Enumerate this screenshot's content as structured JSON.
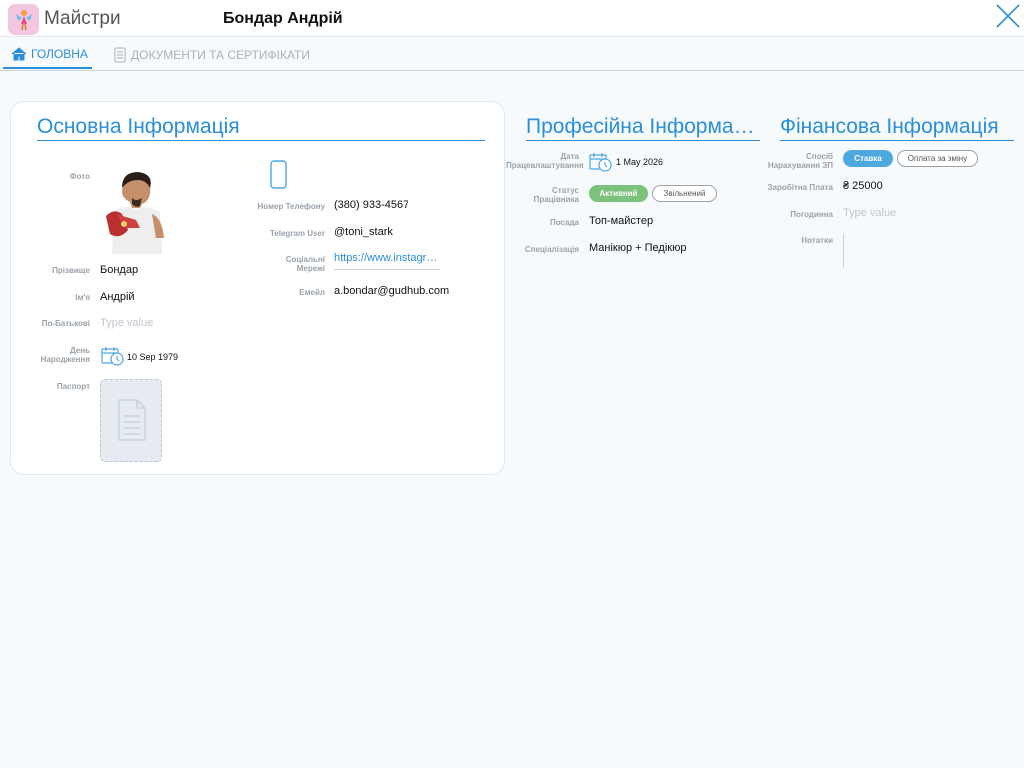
{
  "header": {
    "app_name": "Майстри",
    "record_title": "Бондар Андрій"
  },
  "tabs": [
    {
      "label": "ГОЛОВНА",
      "icon": "home-icon",
      "active": true
    },
    {
      "label": "ДОКУМЕНТИ ТА СЕРТИФІКАТИ",
      "icon": "document-icon",
      "active": false
    }
  ],
  "basic": {
    "title": "Основна Інформація",
    "photo_label": "Фото",
    "surname_label": "Прізвище",
    "surname": "Бондар",
    "name_label": "Ім'я",
    "name": "Андрій",
    "patronymic_label": "По-Батькові",
    "patronymic_placeholder": "Type value",
    "birthday_label_1": "День",
    "birthday_label_2": "Народження",
    "birthday": "10 Sep 1979",
    "passport_label": "Паспорт",
    "phone_label": "Номер Телефону",
    "phone": "(380) 933-4567",
    "telegram_label": "Telegram User",
    "telegram": "@toni_stark",
    "social_label_1": "Соціальні",
    "social_label_2": "Мережі",
    "social": "https://www.instagram.com/toni_stark",
    "email_label": "Емейл",
    "email": "a.bondar@gudhub.com"
  },
  "professional": {
    "title": "Професійна Інформація",
    "hire_label_1": "Дата",
    "hire_label_2": "Працевлаштування",
    "hire_date": "1 May 2026",
    "status_label_1": "Статус",
    "status_label_2": "Працівника",
    "status_active": "Активний",
    "status_fired": "Звільнений",
    "position_label": "Посада",
    "position": "Топ-майстер",
    "spec_label": "Спеціалізація",
    "spec": "Манікюр + Педікюр"
  },
  "financial": {
    "title": "Фінансова Інформація",
    "method_label_1": "Спосіб",
    "method_label_2": "Нарахування ЗП",
    "method_rate": "Ставка",
    "method_shift": "Оплата за зміну",
    "salary_label": "Заробітна Плата",
    "salary": "₴ 25000",
    "hourly_label": "Погодинна",
    "hourly_placeholder": "Type value",
    "notes_label": "Нотатки"
  },
  "colors": {
    "accent": "#2a8fd6",
    "active_green": "#7cc17c",
    "rate_blue": "#4da8e0"
  }
}
